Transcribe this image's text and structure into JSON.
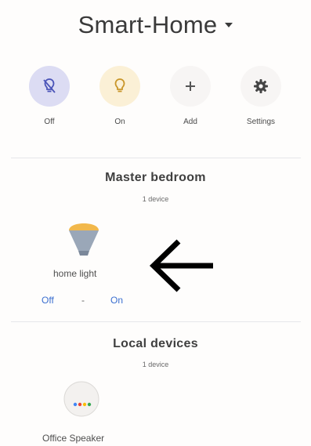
{
  "header": {
    "title": "Smart-Home",
    "caret_icon": "caret-down-icon"
  },
  "quick_actions": [
    {
      "label": "Off",
      "icon": "light-off-icon"
    },
    {
      "label": "On",
      "icon": "light-bulb-icon"
    },
    {
      "label": "Add",
      "icon": "plus-icon"
    },
    {
      "label": "Settings",
      "icon": "gear-icon"
    }
  ],
  "rooms": [
    {
      "name": "Master bedroom",
      "count": "1 device",
      "device": {
        "name": "home light",
        "icon": "light-bulb-icon",
        "off_label": "Off",
        "separator": "-",
        "on_label": "On"
      }
    },
    {
      "name": "Local devices",
      "count": "1 device",
      "device": {
        "name": "Office Speaker",
        "icon": "speaker-icon"
      }
    }
  ],
  "annotation": {
    "icon": "arrow-left-icon"
  },
  "colors": {
    "accent_blue": "#3b6fd0",
    "bulb_on": "#f2b84b",
    "bulb_off_bg": "#dcdcf3",
    "on_bg": "#fbf0d6",
    "bulb_base": "#9aa7b8"
  }
}
